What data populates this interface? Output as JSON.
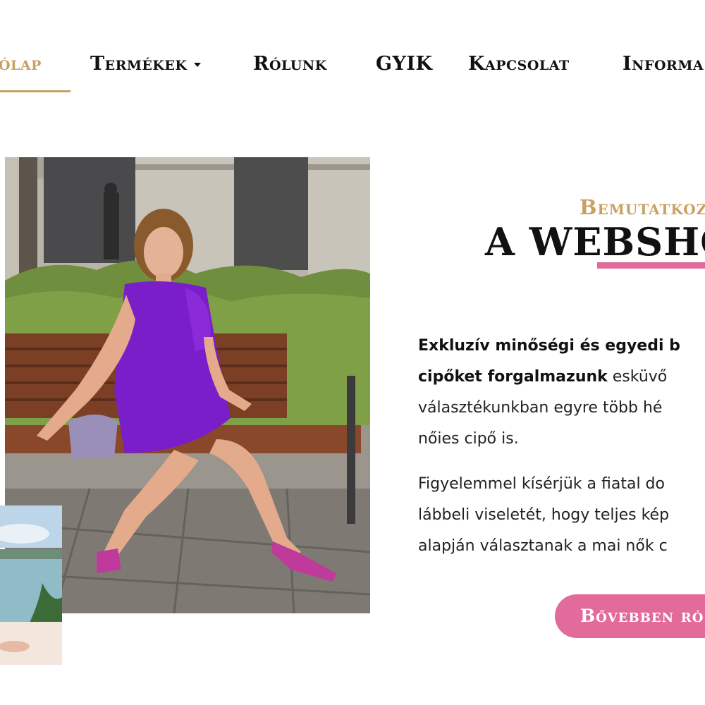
{
  "nav": {
    "items": [
      {
        "label": "Főlap",
        "visible": "ólap",
        "active": true
      },
      {
        "label": "Termékek",
        "has_dropdown": true
      },
      {
        "label": "Rólunk"
      },
      {
        "label": "GYIK"
      },
      {
        "label": "Kapcsolat"
      },
      {
        "label": "Informa"
      }
    ]
  },
  "hero": {
    "subtitle": "Bemutatkoz",
    "title": "A WEBSHO",
    "paragraph1": {
      "line1_bold": "Exkluzív minőségi és egyedi b",
      "line2_bold": "cipőket forgalmazunk",
      "line2_rest": " esküvő",
      "line3": "választékunkban egyre több hé",
      "line4": "nőies cipő is."
    },
    "paragraph2": {
      "line1": "Figyelemmel kísérjük a fiatal do",
      "line2": "lábbeli viseletét, hogy teljes kép",
      "line3": "alapján választanak a mai nők c"
    },
    "button_label": "Bővebben ró"
  },
  "colors": {
    "accent_gold": "#c9a062",
    "accent_pink": "#e36b9b",
    "text_dark": "#111111"
  }
}
